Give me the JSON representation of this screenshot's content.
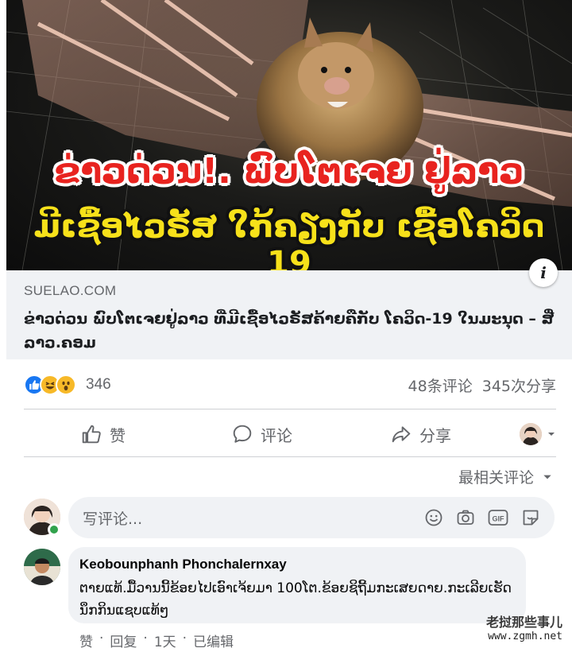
{
  "hero": {
    "headline_line1": "ຂ່າວດ່ວນ!. ພົບໂຕເຈຍ ຢູ່ລາວ",
    "headline_line2": "ມີເຊື້ອໄວຣັສ ໃກ້ຄຽງກັບ ເຊື້ອໂຄວິດ 19",
    "info_label": "i",
    "headline_colors": {
      "line1": "#e8231f",
      "line2": "#f7e11a"
    }
  },
  "link": {
    "domain": "SUELAO.COM",
    "title": "ຂ່າວດ່ວນ ພົບໂຕເຈຍຢູ່ລາວ ທີ່ມີເຊື້ອໄວຣັສຄ້າຍຄືກັບ ໂຄວິດ-19 ໃນມະນຸດ – ສື່ ລາວ.ຄອມ"
  },
  "stats": {
    "reaction_icons": [
      "like-icon",
      "haha-icon",
      "wow-icon"
    ],
    "reaction_count": "346",
    "comments": "48条评论",
    "shares": "345次分享"
  },
  "actions": {
    "like": "赞",
    "comment": "评论",
    "share": "分享"
  },
  "sort": {
    "label": "最相关评论"
  },
  "composer": {
    "placeholder": "写评论...",
    "icons": [
      "emoji-icon",
      "camera-icon",
      "gif-icon",
      "sticker-icon"
    ]
  },
  "comment": {
    "author": "Keobounphanh Phonchalernxay",
    "text": "ຕາຍແທ້.ມື້ວານນີ້ຂ້ອຍໄປເອົາເຈ້ຍມາ 100ໂຕ.ຂ້ອຍຊິຖີ້ມກະເສຍດາຍ.ກະເລີຍເຮັດນຶກກິນແຊບແທ້ໆ",
    "like": "赞",
    "reply": "回复",
    "time": "1天",
    "edited": "已编辑"
  },
  "watermark": {
    "line1": "老挝那些事儿",
    "line2": "www.zgmh.net"
  },
  "colors": {
    "accent": "#1877f2",
    "muted": "#65676b",
    "surface": "#f0f2f5",
    "online": "#31a24c"
  }
}
